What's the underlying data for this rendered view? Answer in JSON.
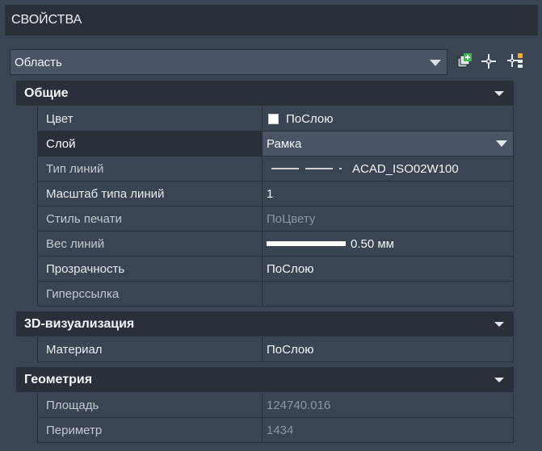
{
  "panel_title": "СВОЙСТВА",
  "object_selector": {
    "value": "Область"
  },
  "toolbar": {
    "icons": [
      "quick-select-icon",
      "select-objects-icon",
      "toggle-pickadd-icon"
    ]
  },
  "sections": {
    "general": {
      "title": "Общие",
      "rows": {
        "color": {
          "label": "Цвет",
          "value": "ПоСлою"
        },
        "layer": {
          "label": "Слой",
          "value": "Рамка"
        },
        "linetype": {
          "label": "Тип линий",
          "value": "ACAD_ISO02W100"
        },
        "linetype_scale": {
          "label": "Масштаб типа линий",
          "value": "1"
        },
        "plot_style": {
          "label": "Стиль печати",
          "value": "ПоЦвету"
        },
        "lineweight": {
          "label": "Вес линий",
          "value": "0.50 мм"
        },
        "transparency": {
          "label": "Прозрачность",
          "value": "ПоСлою"
        },
        "hyperlink": {
          "label": "Гиперссылка",
          "value": ""
        }
      }
    },
    "visualization_3d": {
      "title": "3D-визуализация",
      "rows": {
        "material": {
          "label": "Материал",
          "value": "ПоСлою"
        }
      }
    },
    "geometry": {
      "title": "Геометрия",
      "rows": {
        "area": {
          "label": "Площадь",
          "value": "124740.016"
        },
        "perimeter": {
          "label": "Периметр",
          "value": "1434"
        }
      }
    }
  },
  "colors": {
    "background": "#3b4453",
    "header": "#2a303a",
    "field": "#4a5465",
    "disabled_text": "#8d95a1",
    "accent_green": "#3fb950"
  }
}
